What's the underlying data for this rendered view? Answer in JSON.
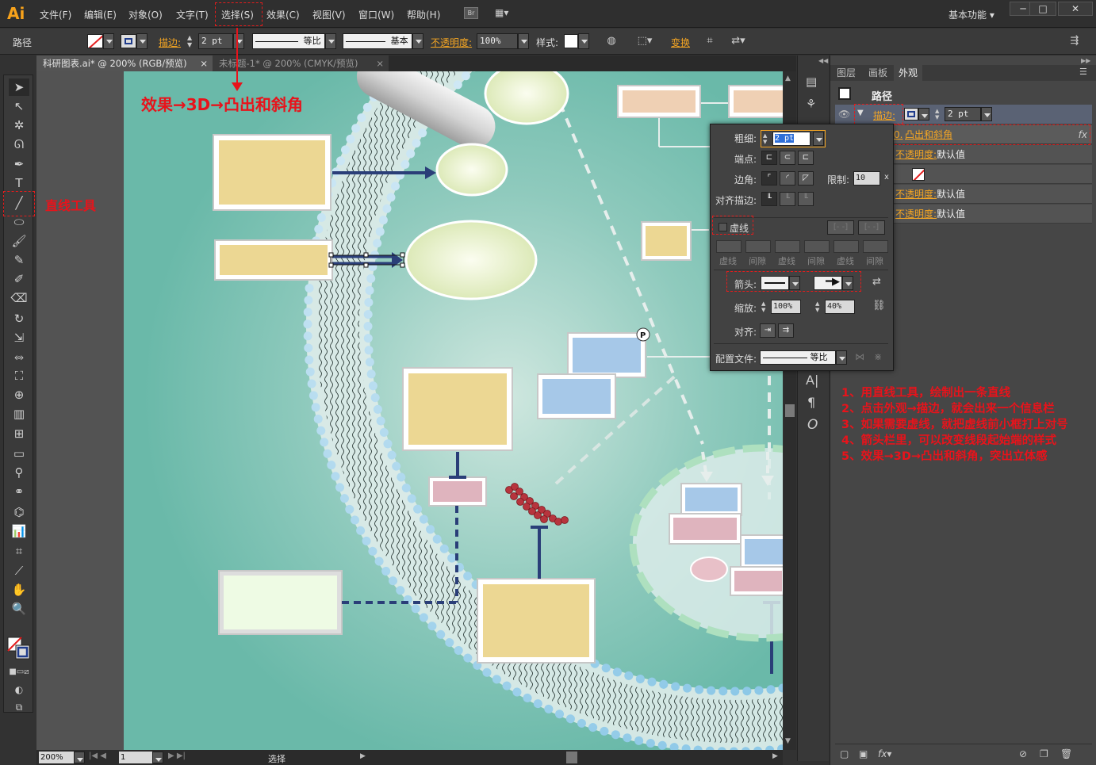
{
  "app": {
    "logo": "Ai",
    "workspace": "基本功能"
  },
  "menu": [
    "文件(F)",
    "编辑(E)",
    "对象(O)",
    "文字(T)",
    "选择(S)",
    "效果(C)",
    "视图(V)",
    "窗口(W)",
    "帮助(H)"
  ],
  "bridge_label": "Br",
  "window_controls": [
    "─",
    "□",
    "✕"
  ],
  "control_bar": {
    "object_type": "路径",
    "stroke_label": "描边:",
    "stroke_weight": "2 pt",
    "profile_label": "等比",
    "brush_label": "基本",
    "opacity_label": "不透明度:",
    "opacity_value": "100%",
    "style_label": "样式:",
    "transform_label": "变换"
  },
  "tabs": [
    {
      "title": "科研图表.ai* @ 200% (RGB/预览)",
      "close": "×",
      "active": true
    },
    {
      "title": "未标题-1* @ 200% (CMYK/预览)",
      "close": "×",
      "active": false
    }
  ],
  "annotations": {
    "effect_path": "效果→3D→凸出和斜角",
    "line_tool": "直线工具",
    "steps": [
      "1、用直线工具，绘制出一条直线",
      "2、点击外观→描边，就会出来一个信息栏",
      "3、如果需要虚线，就把虚线前小框打上对号",
      "4、箭头栏里，可以改变线段起始端的样式",
      "5、效果→3D→凸出和斜角，突出立体感"
    ]
  },
  "stroke_panel": {
    "weight_label": "粗细:",
    "weight_value": "2 pt",
    "cap_label": "端点:",
    "corner_label": "边角:",
    "limit_label": "限制:",
    "limit_value": "10",
    "limit_unit": "x",
    "align_label": "对齐描边:",
    "dashed_label": "虚线",
    "dash_cols": [
      "虚线",
      "间隙",
      "虚线",
      "间隙",
      "虚线",
      "间隙"
    ],
    "arrow_label": "箭头:",
    "scale_label": "缩放:",
    "scale_start": "100%",
    "scale_end": "40%",
    "align_arrow_label": "对齐:",
    "profile_label": "配置文件:",
    "profile_value": "等比"
  },
  "appearance_panel": {
    "tabs": [
      "图层",
      "画板",
      "外观"
    ],
    "title": "路径",
    "stroke_label": "描边:",
    "stroke_value": "2 pt",
    "effect": "凸出和斜角",
    "rows": [
      {
        "label": "不透明度:",
        "value": "默认值"
      },
      {
        "label": "不透明度:",
        "value": "默认值"
      },
      {
        "label": "不透明度:",
        "value": "默认值"
      }
    ],
    "fx": "fx",
    "effect_index": "0."
  },
  "status": {
    "zoom": "200%",
    "page": "1",
    "mode": "选择"
  },
  "canvas": {
    "anchor_marker": "P"
  },
  "colors": {
    "accent": "#f5a623",
    "annotation": "#e8131b",
    "teal_bg": "#6ab9a9",
    "box_fill": "#ecd793"
  }
}
